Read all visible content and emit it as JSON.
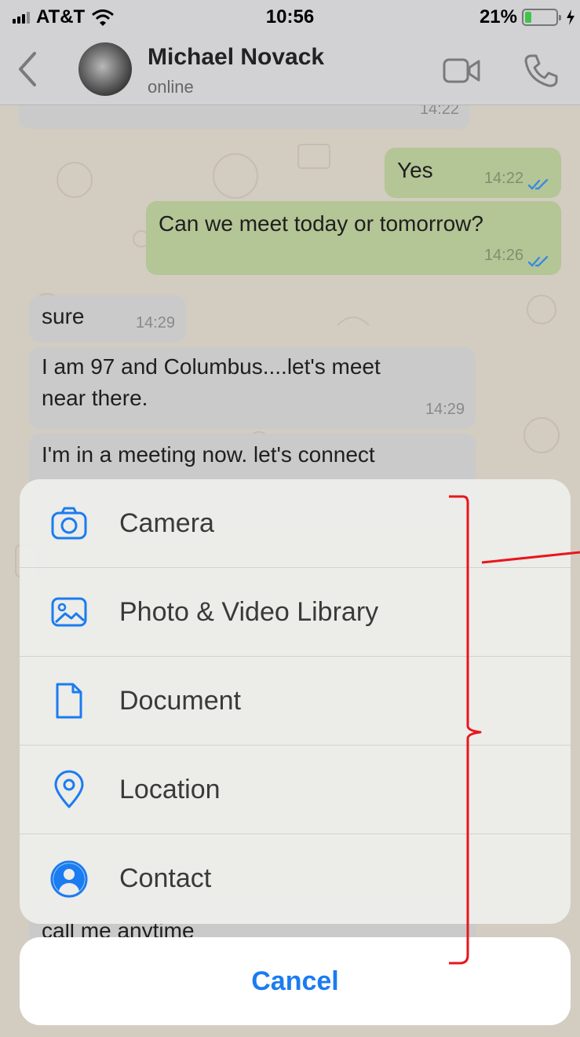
{
  "status_bar": {
    "carrier": "AT&T",
    "time": "10:56",
    "battery_percent": "21%",
    "battery_level": 0.21
  },
  "header": {
    "contact_name": "Michael Novack",
    "contact_status": "online"
  },
  "messages": [
    {
      "direction": "in",
      "text": "",
      "time": "14:22"
    },
    {
      "direction": "out",
      "text": "Yes",
      "time": "14:22"
    },
    {
      "direction": "out",
      "text": "Can we meet today or tomorrow?",
      "time": "14:26"
    },
    {
      "direction": "in",
      "text": "sure",
      "time": "14:29"
    },
    {
      "direction": "in",
      "text_line1": "I am 97 and Columbus....let's meet",
      "text_line2": "near there.",
      "time": "14:29"
    },
    {
      "direction": "in",
      "text": "I'm in a meeting now.  let's connect"
    },
    {
      "direction": "in",
      "text": "call me anytime"
    }
  ],
  "action_sheet": {
    "items": [
      {
        "label": "Camera",
        "icon": "camera-icon"
      },
      {
        "label": "Photo & Video Library",
        "icon": "photo-library-icon"
      },
      {
        "label": "Document",
        "icon": "document-icon"
      },
      {
        "label": "Location",
        "icon": "location-pin-icon"
      },
      {
        "label": "Contact",
        "icon": "contact-person-icon"
      }
    ],
    "cancel_label": "Cancel"
  },
  "colors": {
    "accent": "#1a7cf0",
    "outgoing_bubble": "#b8c99a",
    "incoming_bubble": "#cfcfcf",
    "annotation": "#e8161b"
  }
}
